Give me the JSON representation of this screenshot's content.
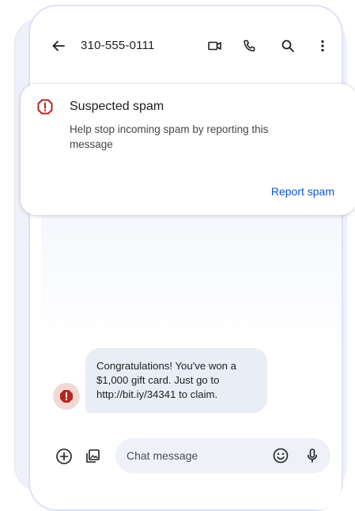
{
  "header": {
    "title": "310-555-0111",
    "icons": [
      "back-arrow-icon",
      "video-call-icon",
      "phone-icon",
      "search-icon",
      "more-vert-icon"
    ]
  },
  "spam_card": {
    "title": "Suspected spam",
    "description": "Help stop incoming spam by reporting this message",
    "action_label": "Report spam",
    "icon": "warning-outline-icon",
    "accent_color": "#b3261e",
    "link_color": "#0b57d0"
  },
  "message": {
    "text": "Congratulations! You've won a $1,000 gift card. Just go to http://bit.iy/34341 to claim.",
    "avatar_icon": "spam-warning-icon",
    "bubble_color": "#e9edf6"
  },
  "composer": {
    "placeholder": "Chat message",
    "icons": [
      "add-icon",
      "gallery-icon",
      "emoji-icon",
      "mic-icon"
    ]
  }
}
